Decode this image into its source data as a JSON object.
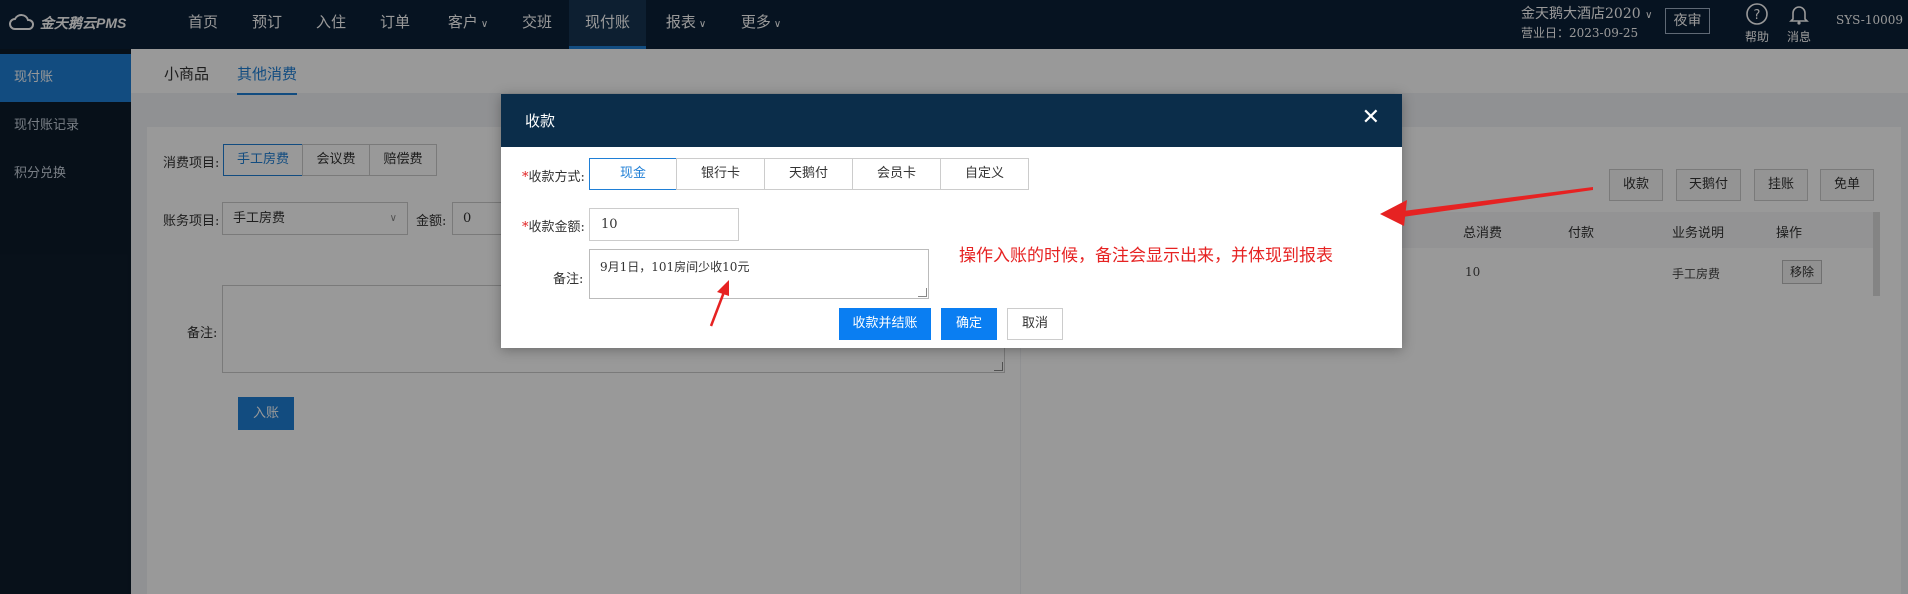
{
  "app": {
    "logo_text": "金天鹅云PMS"
  },
  "nav": {
    "items": [
      {
        "label": "首页"
      },
      {
        "label": "预订"
      },
      {
        "label": "入住"
      },
      {
        "label": "订单"
      },
      {
        "label": "客户"
      },
      {
        "label": "交班"
      },
      {
        "label": "现付账"
      },
      {
        "label": "报表"
      },
      {
        "label": "更多"
      }
    ],
    "active": "现付账"
  },
  "header": {
    "hotel_name": "金天鹅大酒店2020",
    "business_date": "营业日：2023-09-25",
    "night_audit": "夜审",
    "help": "帮助",
    "messages": "消息",
    "user": "SYS-10009"
  },
  "sidebar": {
    "items": [
      {
        "label": "现付账"
      },
      {
        "label": "现付账记录"
      },
      {
        "label": "积分兑换"
      }
    ]
  },
  "subtabs": [
    {
      "label": "小商品"
    },
    {
      "label": "其他消费"
    }
  ],
  "form": {
    "consume_label": "消费项目:",
    "consume_options": [
      "手工房费",
      "会议费",
      "赔偿费"
    ],
    "account_label": "账务项目:",
    "account_value": "手工房费",
    "amount_label": "金额:",
    "amount_value": "0",
    "note_label": "备注:",
    "post_button": "入账"
  },
  "right": {
    "buttons": [
      "收款",
      "天鹅付",
      "挂账",
      "免单"
    ],
    "columns": [
      "总消费",
      "付款",
      "业务说明",
      "操作"
    ],
    "row": {
      "total": "10",
      "payment": "",
      "desc": "手工房费",
      "op": "移除"
    }
  },
  "modal": {
    "title": "收款",
    "method_label": "收款方式:",
    "methods": [
      "现金",
      "银行卡",
      "天鹅付",
      "会员卡",
      "自定义"
    ],
    "amount_label": "收款金额:",
    "amount_value": "10",
    "remark_label": "备注:",
    "remark_value": "9月1日，101房间少收10元",
    "btn_settle": "收款并结账",
    "btn_confirm": "确定",
    "btn_cancel": "取消",
    "required_mark": "*"
  },
  "annotation": "操作入账的时候，备注会显示出来，并体现到报表",
  "colors": {
    "accent": "#1f7fd6",
    "topbar": "#0b2037",
    "annotation": "#e62222"
  }
}
